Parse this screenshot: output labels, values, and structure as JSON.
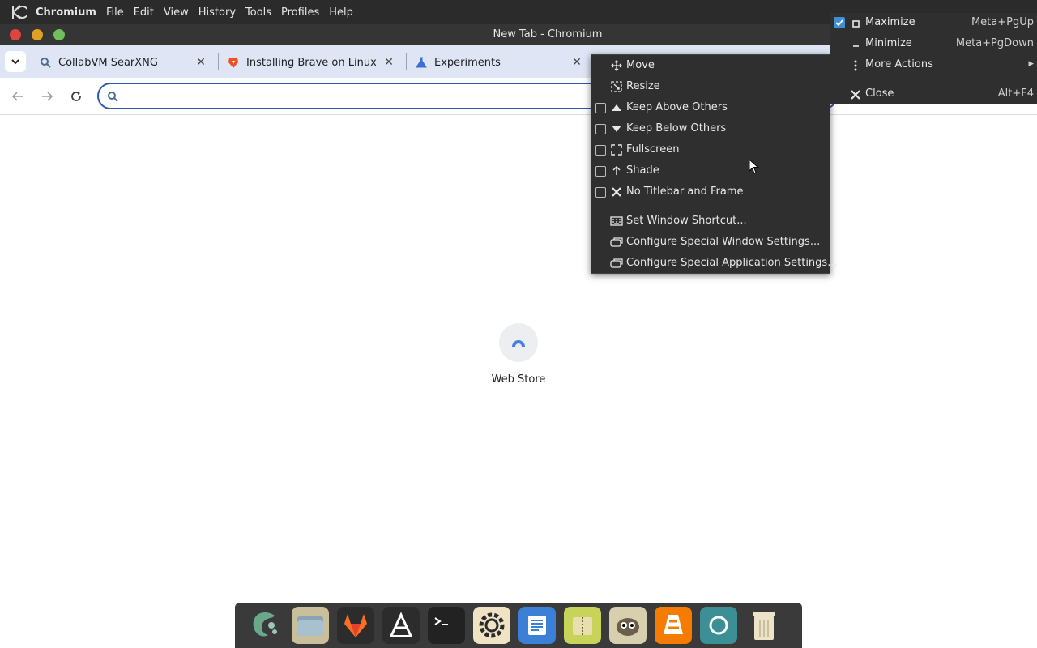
{
  "menubar": {
    "app_name": "Chromium",
    "items": [
      {
        "label": "File"
      },
      {
        "label": "Edit"
      },
      {
        "label": "View"
      },
      {
        "label": "History"
      },
      {
        "label": "Tools"
      },
      {
        "label": "Profiles"
      },
      {
        "label": "Help"
      }
    ]
  },
  "window": {
    "title": "New Tab - Chromium"
  },
  "tabs": [
    {
      "label": "CollabVM SearXNG"
    },
    {
      "label": "Installing Brave on Linux | "
    },
    {
      "label": "Experiments"
    }
  ],
  "content": {
    "shortcut_label": "Web Store"
  },
  "context_menu": {
    "items": [
      {
        "label": "Move"
      },
      {
        "label": "Resize"
      },
      {
        "label": "Keep Above Others"
      },
      {
        "label": "Keep Below Others"
      },
      {
        "label": "Fullscreen"
      },
      {
        "label": "Shade"
      },
      {
        "label": "No Titlebar and Frame"
      },
      {
        "label": "Set Window Shortcut..."
      },
      {
        "label": "Configure Special Window Settings..."
      },
      {
        "label": "Configure Special Application Settings..."
      }
    ]
  },
  "submenu": {
    "items": [
      {
        "label": "Maximize",
        "shortcut": "Meta+PgUp"
      },
      {
        "label": "Minimize",
        "shortcut": "Meta+PgDown"
      },
      {
        "label": "More Actions",
        "shortcut": ""
      },
      {
        "label": "Close",
        "shortcut": "Alt+F4"
      }
    ]
  },
  "dock": {
    "apps": [
      {
        "icon": "krita-icon",
        "color": "#2f5a4a"
      },
      {
        "icon": "files-icon",
        "color": "#c9bf9a"
      },
      {
        "icon": "gitlab-icon",
        "color": "#e24329"
      },
      {
        "icon": "font-app-icon",
        "color": "#2c2c2c"
      },
      {
        "icon": "terminal-icon",
        "color": "#222222"
      },
      {
        "icon": "settings-icon",
        "color": "#efe3c4"
      },
      {
        "icon": "document-viewer-icon",
        "color": "#3c7fd6"
      },
      {
        "icon": "archive-icon",
        "color": "#c8d35a"
      },
      {
        "icon": "gimp-icon",
        "color": "#d8cfae"
      },
      {
        "icon": "vlc-icon",
        "color": "#f57c00"
      },
      {
        "icon": "chromium-icon",
        "color": "#3d8f96"
      },
      {
        "icon": "trash-icon",
        "color": "#ece4c8"
      }
    ]
  }
}
